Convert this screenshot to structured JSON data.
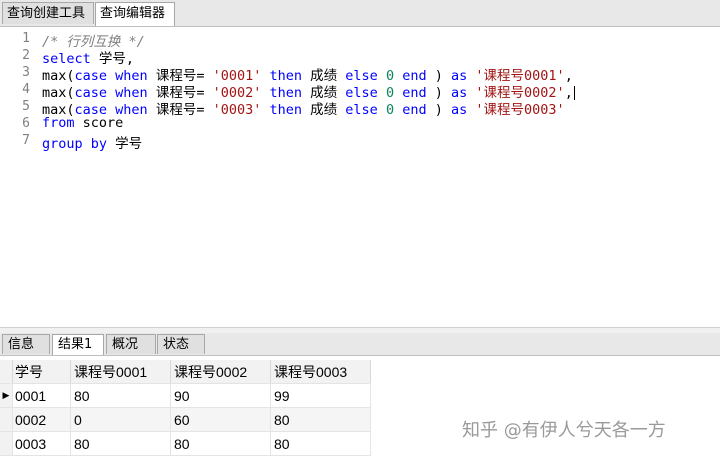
{
  "top_tabs": [
    "查询创建工具",
    "查询编辑器"
  ],
  "editor": {
    "line_numbers": [
      "1",
      "2",
      "3",
      "4",
      "5",
      "6",
      "7"
    ],
    "lines": {
      "l1": "/* 行列互换 */",
      "l2": {
        "kw": "select",
        "rest": " 学号,"
      },
      "l3": {
        "a": "max(",
        "b": "case",
        "c": " ",
        "d": "when",
        "e": " 课程号= ",
        "f": "'0001'",
        "g": " ",
        "h": "then",
        "i": " 成绩 ",
        "j": "else",
        "k": " ",
        "l": "0",
        "m": " ",
        "n": "end",
        "o": " ) ",
        "p": "as",
        "q": " ",
        "r": "'课程号0001'",
        "s": ","
      },
      "l4": {
        "a": "max(",
        "b": "case",
        "c": " ",
        "d": "when",
        "e": " 课程号= ",
        "f": "'0002'",
        "g": " ",
        "h": "then",
        "i": " 成绩 ",
        "j": "else",
        "k": " ",
        "l": "0",
        "m": " ",
        "n": "end",
        "o": " ) ",
        "p": "as",
        "q": " ",
        "r": "'课程号0002'",
        "s": ","
      },
      "l5": {
        "a": "max(",
        "b": "case",
        "c": " ",
        "d": "when",
        "e": " 课程号= ",
        "f": "'0003'",
        "g": " ",
        "h": "then",
        "i": " 成绩 ",
        "j": "else",
        "k": " ",
        "l": "0",
        "m": " ",
        "n": "end",
        "o": " ) ",
        "p": "as",
        "q": " ",
        "r": "'课程号0003'",
        "s": ""
      },
      "l6": {
        "kw": "from",
        "rest": " score"
      },
      "l7": {
        "kw": "group by",
        "rest": " 学号"
      }
    }
  },
  "bottom_tabs": [
    "信息",
    "结果1",
    "概况",
    "状态"
  ],
  "results": {
    "columns": [
      "学号",
      "课程号0001",
      "课程号0002",
      "课程号0003"
    ],
    "rows": [
      [
        "0001",
        "80",
        "90",
        "99"
      ],
      [
        "0002",
        "0",
        "60",
        "80"
      ],
      [
        "0003",
        "80",
        "80",
        "80"
      ]
    ],
    "current_row_marker": "▶"
  },
  "watermark": "知乎 @有伊人兮天各一方",
  "colors": {
    "keyword": "#0000ff",
    "string": "#a31515",
    "number": "#098658",
    "comment": "#808080"
  }
}
